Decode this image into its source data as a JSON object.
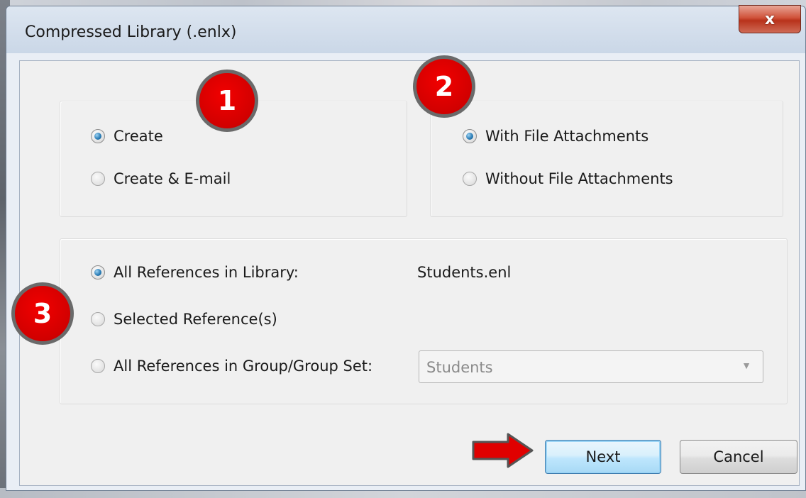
{
  "window": {
    "title": "Compressed Library (.enlx)",
    "close_label": "x"
  },
  "action_group": {
    "options": [
      {
        "label": "Create",
        "checked": true
      },
      {
        "label": "Create & E-mail",
        "checked": false
      }
    ]
  },
  "attachment_group": {
    "options": [
      {
        "label": "With File Attachments",
        "checked": true
      },
      {
        "label": "Without File Attachments",
        "checked": false
      }
    ]
  },
  "reference_group": {
    "all_in_library": {
      "label": "All References in Library:",
      "checked": true
    },
    "library_name": "Students.enl",
    "selected": {
      "label": "Selected Reference(s)",
      "checked": false
    },
    "in_group": {
      "label": "All References in Group/Group Set:",
      "checked": false
    },
    "group_combo": {
      "selected": "Students"
    }
  },
  "buttons": {
    "next_label": "Next",
    "cancel_label": "Cancel"
  },
  "annotations": {
    "badges": [
      "1",
      "2",
      "3"
    ],
    "badge_color": "#e00000",
    "arrow_color": "#e00000"
  },
  "icons": {
    "close": "close-icon",
    "combo_arrow": "chevron-down-icon",
    "pointer": "arrow-right-icon"
  }
}
